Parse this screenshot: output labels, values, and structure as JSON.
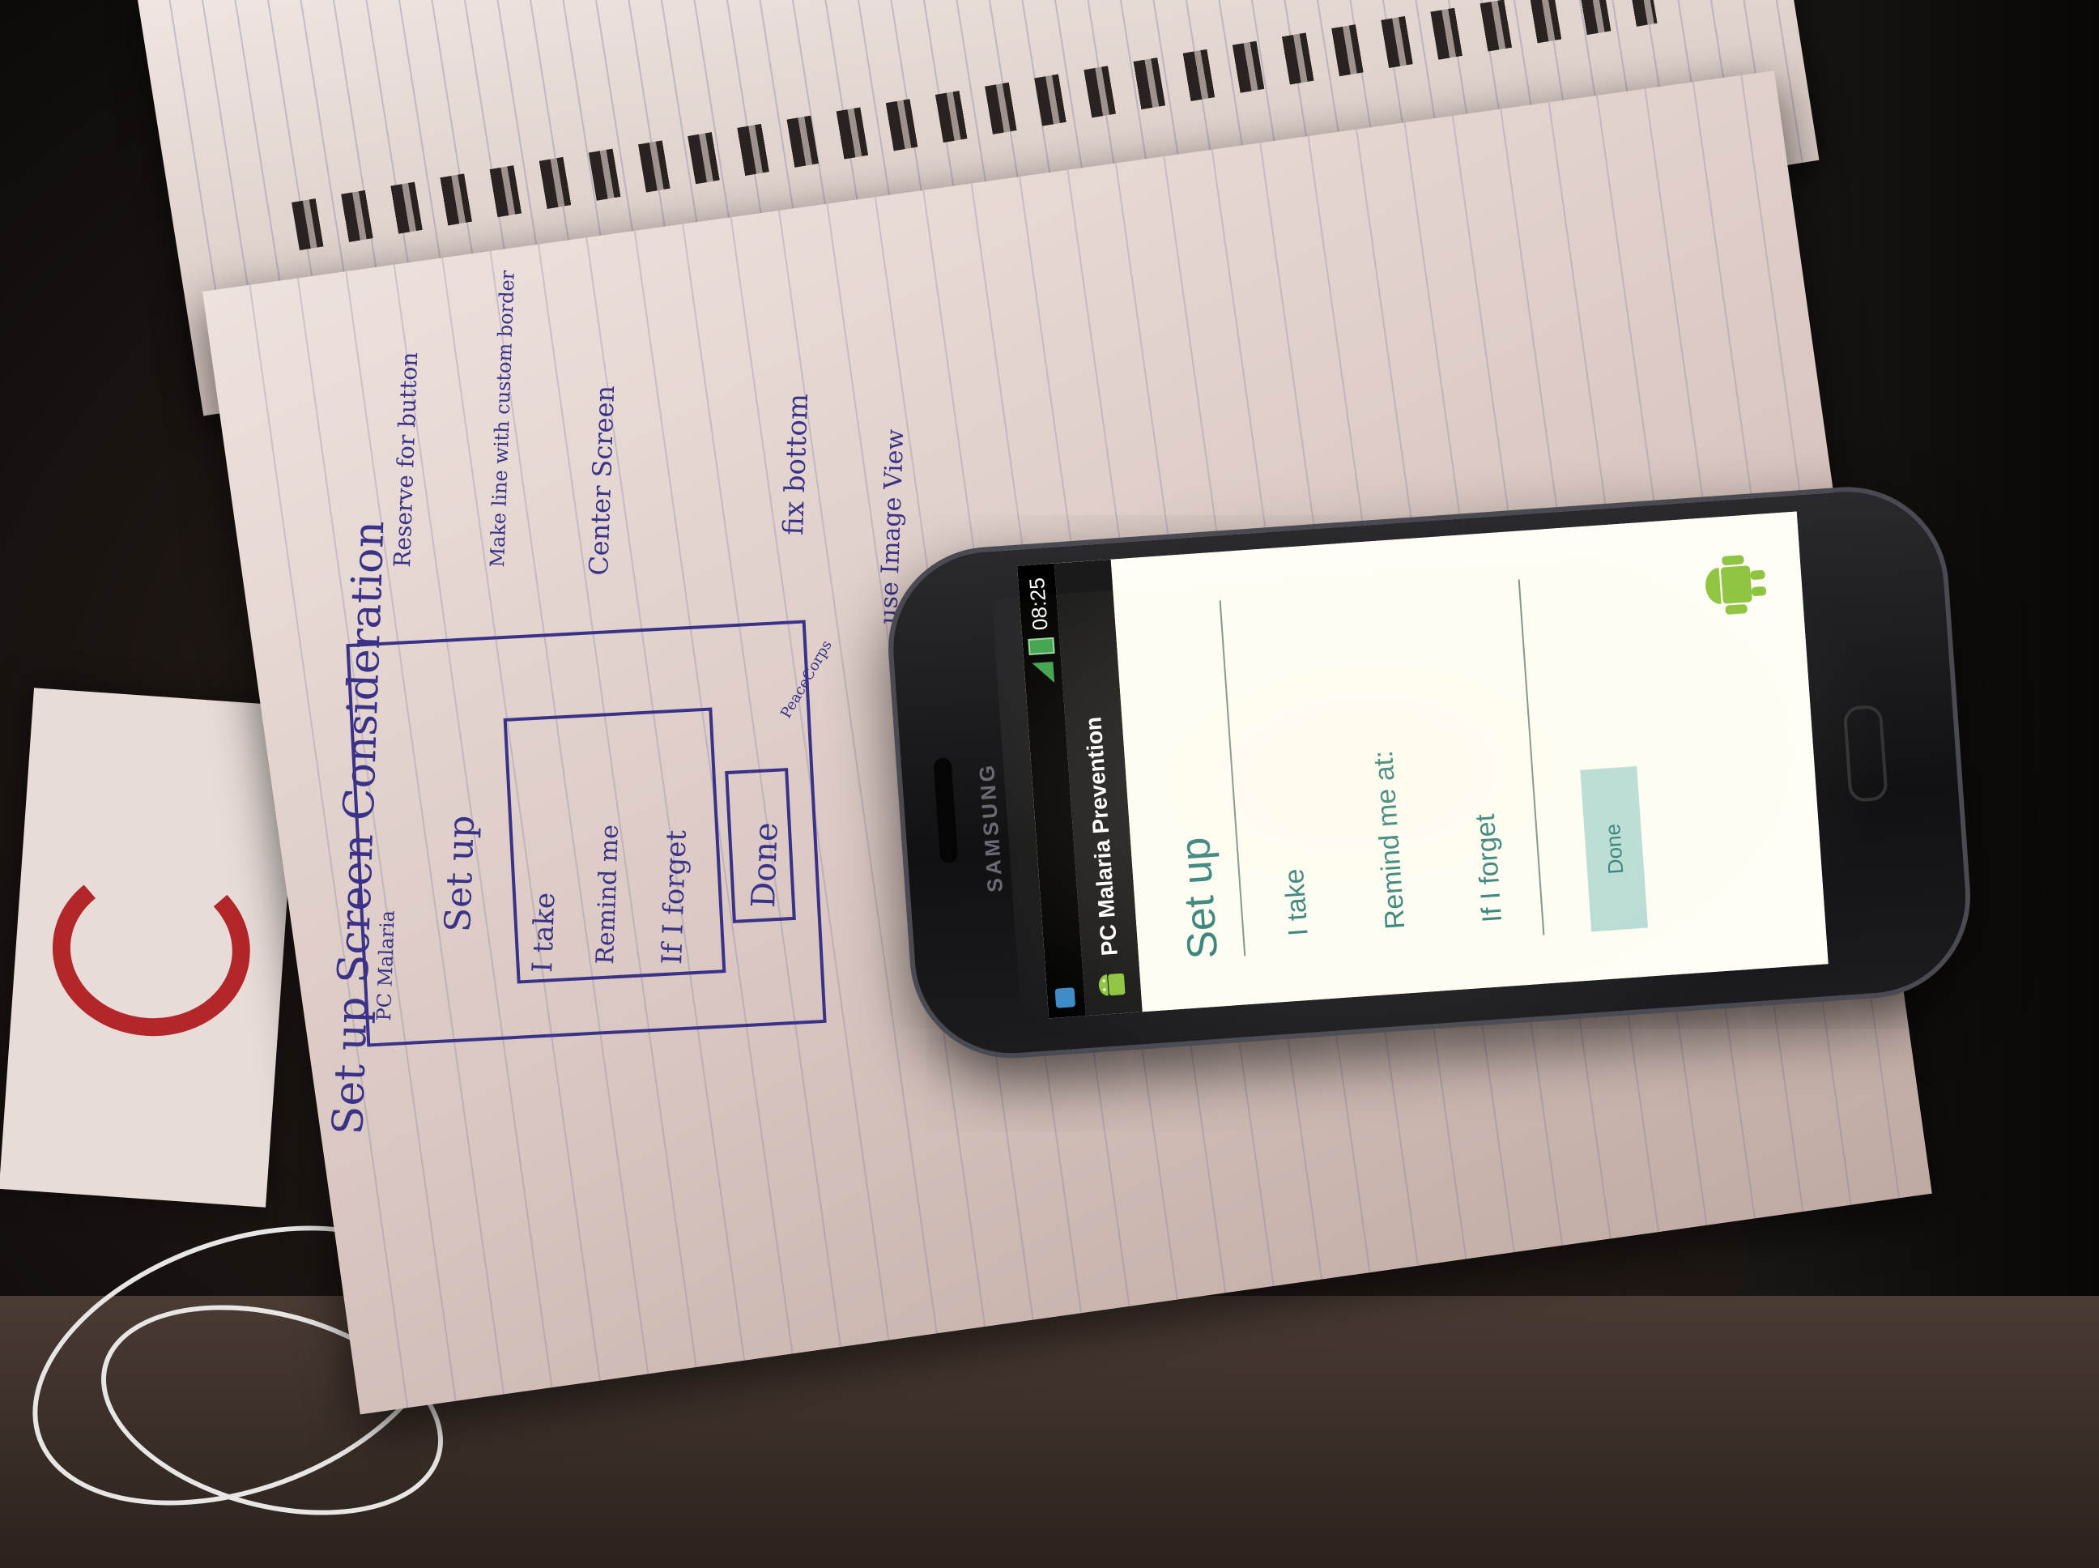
{
  "sketch": {
    "title": "Set up Screen Consideration",
    "header_box": "PC Malaria",
    "screen_title": "Set up",
    "rows": [
      "I take",
      "Remind me",
      "If I forget"
    ],
    "button": "Done",
    "notes": {
      "reserve": "Reserve for button",
      "make_line": "Make line with custom border",
      "center": "Center Screen",
      "fix_bottom": "fix bottom",
      "image_view": "use Image View",
      "peacecorps": "PeaceCorps"
    }
  },
  "phone": {
    "brand": "SAMSUNG",
    "status_time": "08:25",
    "app_title": "PC Malaria Prevention",
    "screen_heading": "Set up",
    "field_take": "I take",
    "field_remind": "Remind me at:",
    "field_forget": "If I forget",
    "done_button": "Done",
    "icons": {
      "app": "android-icon",
      "bottom": "android-robot-icon",
      "signal": "signal-icon",
      "battery": "battery-icon",
      "notification": "notification-icon"
    },
    "colors": {
      "accent": "#2e7f7a",
      "button_bg": "#b6dcd6",
      "android_green": "#8ec43f"
    }
  }
}
